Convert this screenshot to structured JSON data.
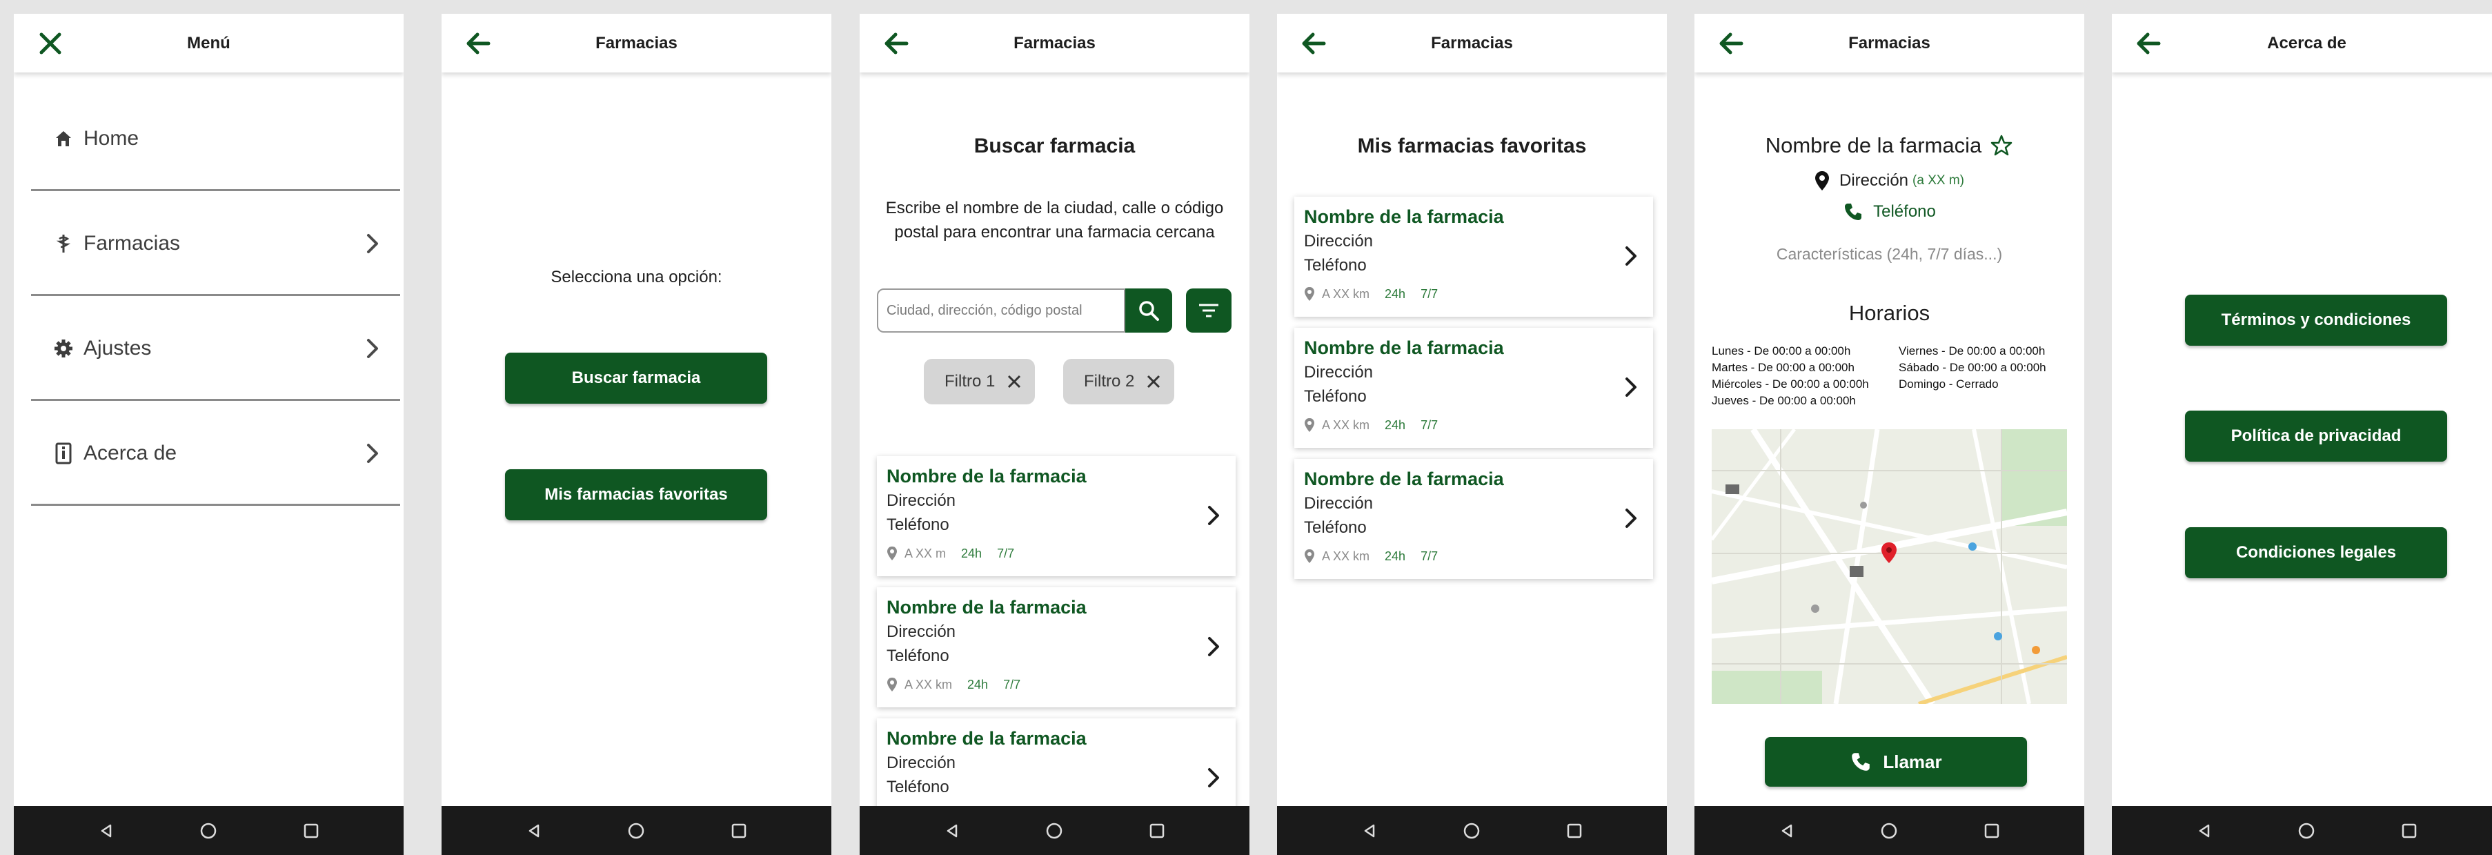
{
  "colors": {
    "accent": "#0f5722",
    "background": "#e5e5e5",
    "navbar": "#1a1a1a"
  },
  "screens": {
    "menu": {
      "title": "Menú",
      "items": [
        {
          "label": "Home",
          "icon": "home-icon"
        },
        {
          "label": "Farmacias",
          "icon": "pharmacy-icon"
        },
        {
          "label": "Ajustes",
          "icon": "gear-icon"
        },
        {
          "label": "Acerca de",
          "icon": "info-icon"
        }
      ]
    },
    "farmacias": {
      "title": "Farmacias",
      "prompt": "Selecciona una opción:",
      "btn_search": "Buscar farmacia",
      "btn_favorites": "Mis farmacias favoritas"
    },
    "search": {
      "title": "Farmacias",
      "heading": "Buscar farmacia",
      "description_1": "Escribe el nombre de la ciudad, calle o código",
      "description_2": "postal para encontrar una farmacia cercana",
      "placeholder": "Ciudad, dirección, código postal",
      "filters": [
        "Filtro 1",
        "Filtro 2"
      ],
      "cards": [
        {
          "name": "Nombre de la farmacia",
          "address": "Dirección",
          "phone": "Teléfono",
          "distance": "A XX m",
          "hours": "24h",
          "days": "7/7"
        },
        {
          "name": "Nombre de la farmacia",
          "address": "Dirección",
          "phone": "Teléfono",
          "distance": "A XX km",
          "hours": "24h",
          "days": "7/7"
        },
        {
          "name": "Nombre de la farmacia",
          "address": "Dirección",
          "phone": "Teléfono"
        }
      ]
    },
    "favorites": {
      "title": "Farmacias",
      "heading": "Mis farmacias favoritas",
      "cards": [
        {
          "name": "Nombre de la farmacia",
          "address": "Dirección",
          "phone": "Teléfono",
          "distance": "A XX km",
          "hours": "24h",
          "days": "7/7"
        },
        {
          "name": "Nombre de la farmacia",
          "address": "Dirección",
          "phone": "Teléfono",
          "distance": "A XX km",
          "hours": "24h",
          "days": "7/7"
        },
        {
          "name": "Nombre de la farmacia",
          "address": "Dirección",
          "phone": "Teléfono",
          "distance": "A XX km",
          "hours": "24h",
          "days": "7/7"
        }
      ]
    },
    "detail": {
      "title": "Farmacias",
      "name": "Nombre de la farmacia",
      "address": "Dirección",
      "distance": "(a XX m)",
      "phone": "Teléfono",
      "features": "Características (24h, 7/7 días...)",
      "schedule_title": "Horarios",
      "schedule_left": [
        "Lunes - De 00:00 a 00:00h",
        "Martes - De 00:00 a 00:00h",
        "Miércoles - De 00:00 a 00:00h",
        "Jueves - De 00:00 a 00:00h"
      ],
      "schedule_right": [
        "Viernes - De 00:00 a 00:00h",
        "Sábado - De 00:00 a 00:00h",
        "Domingo - Cerrado"
      ],
      "call_label": "Llamar"
    },
    "about": {
      "title": "Acerca de",
      "buttons": [
        "Términos y condiciones",
        "Política de privacidad",
        "Condiciones legales"
      ]
    }
  }
}
